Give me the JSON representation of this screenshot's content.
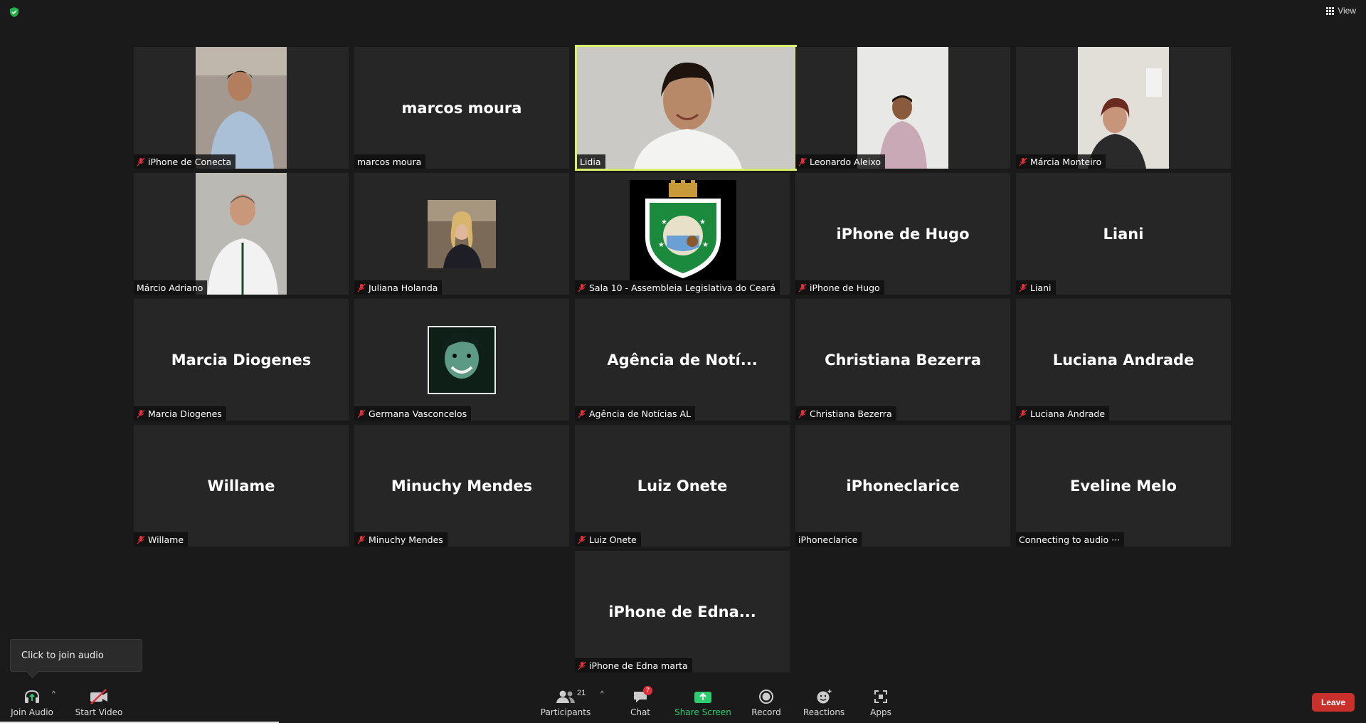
{
  "top": {
    "view_label": "View"
  },
  "tiles": [
    {
      "id": "t0",
      "name": "",
      "label": "iPhone de Conecta",
      "muted": true,
      "photo": "man-blue-shirt",
      "bg": "#9b8f86"
    },
    {
      "id": "t1",
      "name": "marcos moura",
      "label": "marcos moura",
      "muted": false
    },
    {
      "id": "t2",
      "name": "",
      "label": "Lidia",
      "muted": false,
      "active": true,
      "photo": "woman-speaking",
      "bg": "#c9c7c5"
    },
    {
      "id": "t3",
      "name": "",
      "label": "Leonardo Aleixo",
      "muted": true,
      "photo": "man-striped-shirt",
      "bg": "#e3e3e1"
    },
    {
      "id": "t4",
      "name": "",
      "label": "Márcia Monteiro",
      "muted": true,
      "photo": "woman-glasses",
      "bg": "#dedbd5"
    },
    {
      "id": "t5",
      "name": "",
      "label": "Márcio Adriano",
      "muted": false,
      "photo": "man-lanyard",
      "bg": "#b8b6b1"
    },
    {
      "id": "t6",
      "name": "",
      "label": "Juliana Holanda",
      "muted": true,
      "photo": "woman-blonde",
      "bg": "#7b6a58"
    },
    {
      "id": "t7",
      "name": "",
      "label": "Sala 10 - Assembleia Legislativa do Ceará",
      "muted": true,
      "photo": "state-coat-of-arms",
      "bg": "#000000"
    },
    {
      "id": "t8",
      "name": "iPhone de Hugo",
      "label": "iPhone de Hugo",
      "muted": true
    },
    {
      "id": "t9",
      "name": "Liani",
      "label": "Liani",
      "muted": true
    },
    {
      "id": "t10",
      "name": "Marcia Diogenes",
      "label": "Marcia Diogenes",
      "muted": true
    },
    {
      "id": "t11",
      "name": "",
      "label": "Germana Vasconcelos",
      "muted": true,
      "photo": "woman-smiling-dark",
      "bg": "#1c3a2e"
    },
    {
      "id": "t12",
      "name": "Agência de Notí...",
      "label": "Agência de Notícias AL",
      "muted": true
    },
    {
      "id": "t13",
      "name": "Christiana Bezerra",
      "label": "Christiana Bezerra",
      "muted": true
    },
    {
      "id": "t14",
      "name": "Luciana Andrade",
      "label": "Luciana Andrade",
      "muted": true
    },
    {
      "id": "t15",
      "name": "Willame",
      "label": "Willame",
      "muted": true
    },
    {
      "id": "t16",
      "name": "Minuchy Mendes",
      "label": "Minuchy Mendes",
      "muted": true
    },
    {
      "id": "t17",
      "name": "Luiz Onete",
      "label": "Luiz Onete",
      "muted": true
    },
    {
      "id": "t18",
      "name": "iPhoneclarice",
      "label": "iPhoneclarice",
      "muted": false
    },
    {
      "id": "t19",
      "name": "Eveline Melo",
      "label": "Connecting to audio ···",
      "muted": false
    },
    {
      "id": "t20",
      "name": "iPhone de Edna...",
      "label": "iPhone de Edna marta",
      "muted": true
    }
  ],
  "tooltip": {
    "text": "Click to join audio"
  },
  "toolbar": {
    "join_audio": "Join Audio",
    "start_video": "Start Video",
    "participants": "Participants",
    "participants_count": "21",
    "chat": "Chat",
    "chat_badge": "7",
    "share_screen": "Share Screen",
    "record": "Record",
    "reactions": "Reactions",
    "apps": "Apps",
    "leave": "Leave"
  },
  "colors": {
    "active_border": "#d8f06a",
    "leave": "#c9302c",
    "share": "#2ecc71",
    "muted_mic": "#e0303a"
  }
}
